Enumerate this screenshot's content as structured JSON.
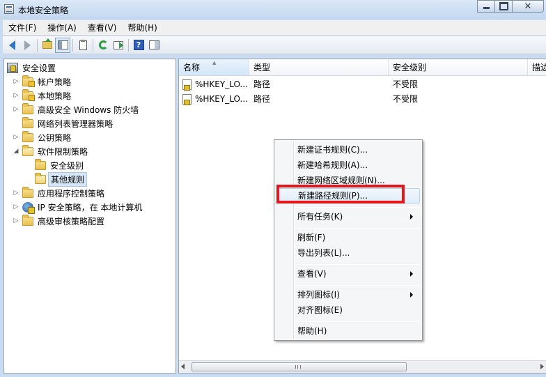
{
  "window": {
    "title": "本地安全策略"
  },
  "menubar": {
    "items": [
      "文件(F)",
      "操作(A)",
      "查看(V)",
      "帮助(H)"
    ]
  },
  "toolbar": {
    "icons": [
      "back-arrow-icon",
      "forward-arrow-icon",
      "up-folder-icon",
      "show-hide-console-tree-icon",
      "properties-icon",
      "refresh-icon",
      "export-list-icon",
      "help-icon",
      "action-pane-icon"
    ]
  },
  "tree": {
    "items": [
      {
        "label": "安全设置",
        "expander": "",
        "icon": "security-settings-icon"
      },
      {
        "label": "帐户策略",
        "expander": "▷",
        "icon": "folder-icon"
      },
      {
        "label": "本地策略",
        "expander": "▷",
        "icon": "folder-icon"
      },
      {
        "label": "高级安全 Windows 防火墙",
        "expander": "▷",
        "icon": "folder-icon"
      },
      {
        "label": "网络列表管理器策略",
        "expander": "",
        "icon": "folder-icon"
      },
      {
        "label": "公钥策略",
        "expander": "▷",
        "icon": "folder-icon"
      },
      {
        "label": "软件限制策略",
        "expander": "◢",
        "icon": "folder-icon"
      },
      {
        "label": "安全级别",
        "expander": "",
        "icon": "folder-icon"
      },
      {
        "label": "其他规则",
        "expander": "",
        "icon": "folder-icon",
        "selected": true
      },
      {
        "label": "应用程序控制策略",
        "expander": "▷",
        "icon": "folder-icon"
      },
      {
        "label": "IP 安全策略，在 本地计算机",
        "expander": "▷",
        "icon": "ip-security-icon"
      },
      {
        "label": "高级审核策略配置",
        "expander": "▷",
        "icon": "folder-icon"
      }
    ]
  },
  "list": {
    "columns": [
      "名称",
      "类型",
      "安全级别",
      "描边"
    ],
    "rows": [
      {
        "name": "%HKEY_LO...",
        "type": "路径",
        "level": "不受限"
      },
      {
        "name": "%HKEY_LO...",
        "type": "路径",
        "level": "不受限"
      }
    ]
  },
  "context_menu": {
    "items": [
      "新建证书规则(C)...",
      "新建哈希规则(A)...",
      "新建网络区域规则(N)...",
      "新建路径规则(P)...",
      "所有任务(K)",
      "刷新(F)",
      "导出列表(L)...",
      "查看(V)",
      "排列图标(I)",
      "对齐图标(E)",
      "帮助(H)"
    ]
  },
  "colors": {
    "highlight": "#e5161c",
    "selection": "#d7e6f6"
  }
}
